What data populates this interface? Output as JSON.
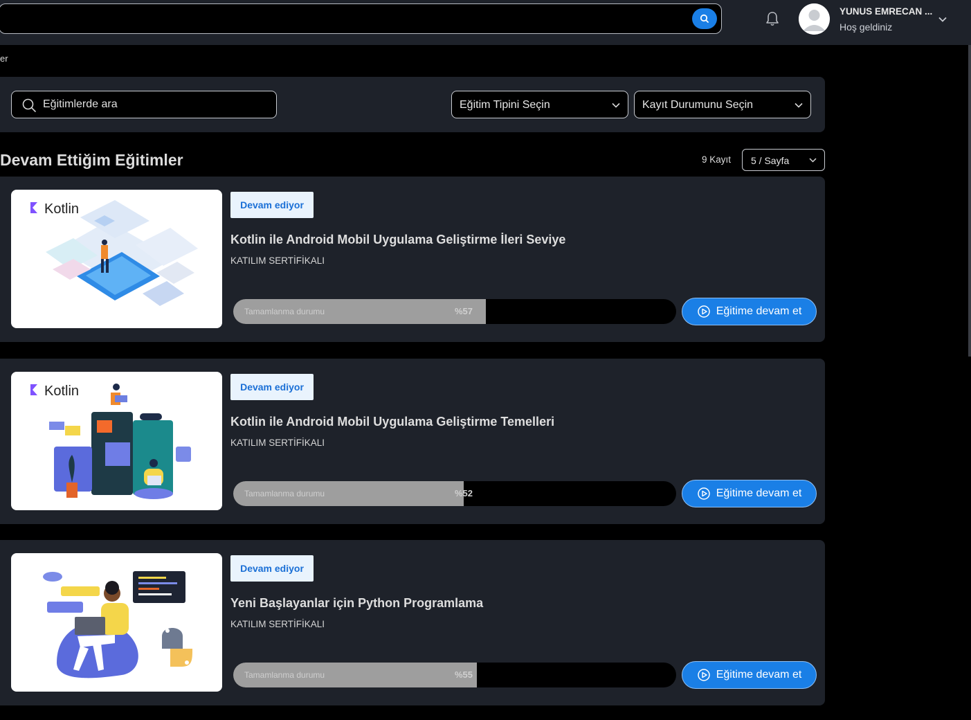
{
  "header": {
    "user_name": "YUNUS EMRECAN ...",
    "greeting": "Hoş geldiniz"
  },
  "breadcrumb": "er",
  "filters": {
    "search_placeholder": "Eğitimlerde ara",
    "type_select": "Eğitim Tipini Seçin",
    "status_select": "Kayıt Durumunu Seçin"
  },
  "section": {
    "title": "Devam Ettiğim Eğitimler",
    "record_count": "9 Kayıt",
    "per_page": "5 / Sayfa"
  },
  "courses": [
    {
      "badge": "Devam ediyor",
      "title": "Kotlin ile Android Mobil Uygulama Geliştirme İleri Seviye",
      "type": "KATILIM SERTİFİKALI",
      "progress_label": "Tamamlanma durumu",
      "progress_text": "%57",
      "progress": 0.57,
      "button": "Eğitime devam et",
      "logo_text": "Kotlin"
    },
    {
      "badge": "Devam ediyor",
      "title": "Kotlin ile Android Mobil Uygulama Geliştirme Temelleri",
      "type": "KATILIM SERTİFİKALI",
      "progress_label": "Tamamlanma durumu",
      "progress_text": "%52",
      "progress": 0.52,
      "button": "Eğitime devam et",
      "logo_text": "Kotlin"
    },
    {
      "badge": "Devam ediyor",
      "title": "Yeni Başlayanlar için Python Programlama",
      "type": "KATILIM SERTİFİKALI",
      "progress_label": "Tamamlanma durumu",
      "progress_text": "%55",
      "progress": 0.55,
      "button": "Eğitime devam et"
    }
  ],
  "colors": {
    "accent": "#1a7fe6",
    "panel": "#1e222a",
    "background": "#000000",
    "badge_bg": "#e9f3fd",
    "progress_fill": "#9e9e9e"
  }
}
